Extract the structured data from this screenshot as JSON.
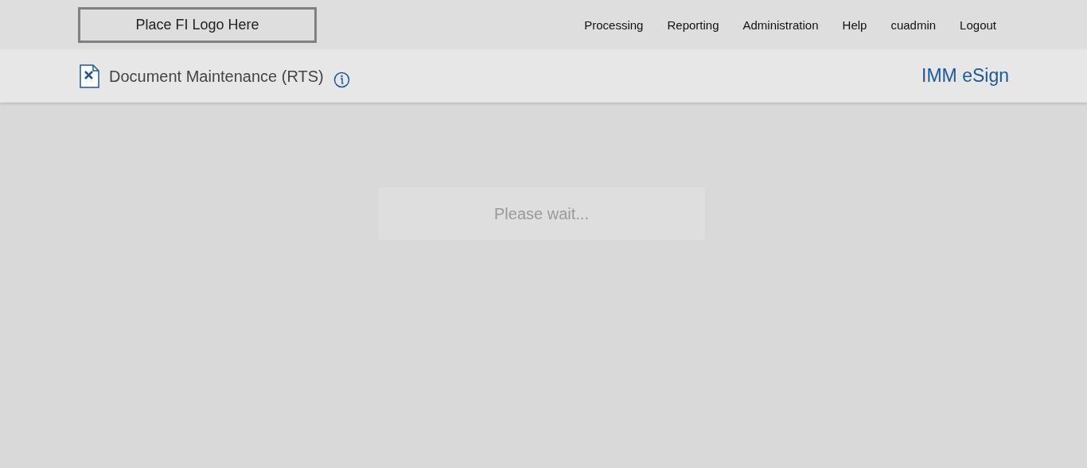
{
  "header": {
    "logo": "Place FI Logo Here",
    "nav": [
      "Processing",
      "Reporting",
      "Administration",
      "Help",
      "cuadmin",
      "Logout"
    ]
  },
  "subheader": {
    "title": "Document Maintenance (RTS)",
    "product": "IMM eSign"
  },
  "loading": {
    "message": "Please wait..."
  }
}
